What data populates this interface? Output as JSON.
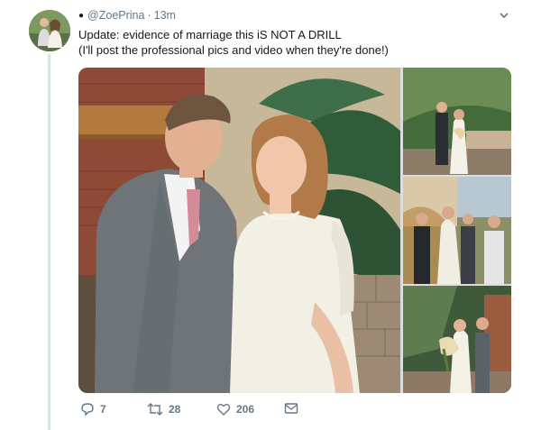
{
  "tweet": {
    "handle": "@ZoePrina",
    "separator": "·",
    "time": "13m",
    "verified_icon": "●",
    "line1": "Update: evidence of marriage this iS NOT A DRILL",
    "line2": "(I'll post the professional pics and video when they're done!)"
  },
  "actions": {
    "reply_count": "7",
    "retweet_count": "28",
    "like_count": "206"
  },
  "icons": {
    "reply": "reply-icon",
    "retweet": "retweet-icon",
    "like": "heart-icon",
    "message": "envelope-icon",
    "menu": "chevron-down-icon"
  },
  "colors": {
    "thread_line": "#c6efd6",
    "meta_text": "#657786",
    "body_text": "#14171a"
  }
}
